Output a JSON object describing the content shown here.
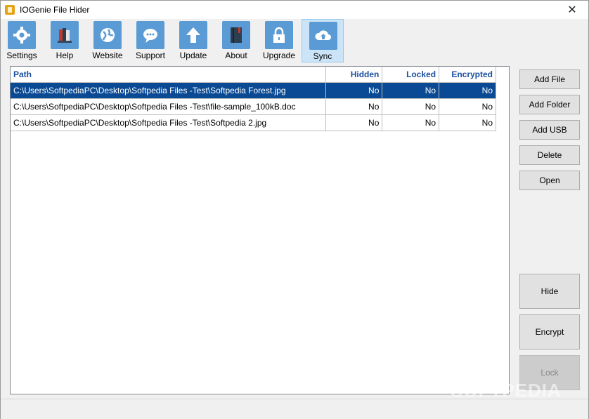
{
  "window": {
    "title": "IOGenie File Hider",
    "close_glyph": "✕"
  },
  "toolbar": {
    "items": [
      {
        "label": "Settings",
        "icon": "gear-icon"
      },
      {
        "label": "Help",
        "icon": "books-icon"
      },
      {
        "label": "Website",
        "icon": "globe-icon"
      },
      {
        "label": "Support",
        "icon": "chat-icon"
      },
      {
        "label": "Update",
        "icon": "arrow-up-icon"
      },
      {
        "label": "About",
        "icon": "book-icon"
      },
      {
        "label": "Upgrade",
        "icon": "lock-icon"
      },
      {
        "label": "Sync",
        "icon": "cloud-upload-icon"
      }
    ]
  },
  "table": {
    "columns": [
      "Path",
      "Hidden",
      "Locked",
      "Encrypted"
    ],
    "rows": [
      {
        "path": "C:\\Users\\SoftpediaPC\\Desktop\\Softpedia Files -Test\\Softpedia Forest.jpg",
        "hidden": "No",
        "locked": "No",
        "encrypted": "No",
        "selected": true
      },
      {
        "path": "C:\\Users\\SoftpediaPC\\Desktop\\Softpedia Files -Test\\file-sample_100kB.doc",
        "hidden": "No",
        "locked": "No",
        "encrypted": "No",
        "selected": false
      },
      {
        "path": "C:\\Users\\SoftpediaPC\\Desktop\\Softpedia Files -Test\\Softpedia 2.jpg",
        "hidden": "No",
        "locked": "No",
        "encrypted": "No",
        "selected": false
      }
    ]
  },
  "side_buttons": {
    "add_file": "Add File",
    "add_folder": "Add Folder",
    "add_usb": "Add USB",
    "delete": "Delete",
    "open": "Open"
  },
  "action_buttons": {
    "hide": "Hide",
    "encrypt": "Encrypt",
    "lock": "Lock"
  },
  "watermark": "SOFTPEDIA"
}
